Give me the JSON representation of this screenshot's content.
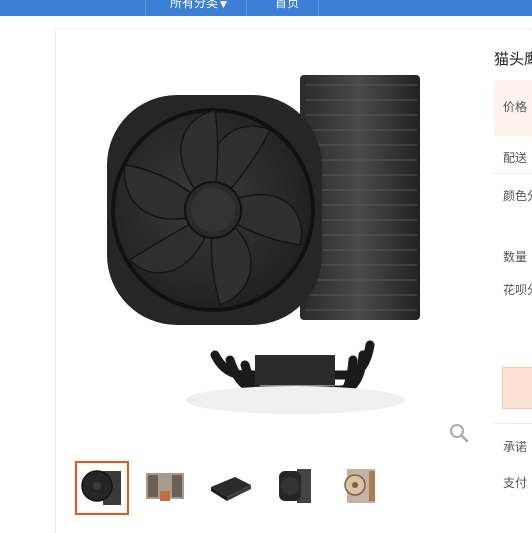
{
  "nav": {
    "categories_label": "所有分类",
    "home_label": "首页"
  },
  "product": {
    "title": "猫头鹰",
    "labels": {
      "price": "价格",
      "delivery": "配送",
      "color": "颜色分",
      "quantity": "数量",
      "installment": "花呗分",
      "promise": "承诺",
      "payment": "支付"
    }
  },
  "gallery": {
    "thumbnails": [
      "cooler-black-dual-fan",
      "cooler-copper-dual-tower",
      "cooler-low-profile-black",
      "cooler-black-single-fan",
      "cooler-copper-beige-fans"
    ],
    "selected_index": 0
  },
  "colors": {
    "nav_bg": "#3c7fd8",
    "accent": "#e05a14",
    "price_bg": "#fdf3ec"
  }
}
